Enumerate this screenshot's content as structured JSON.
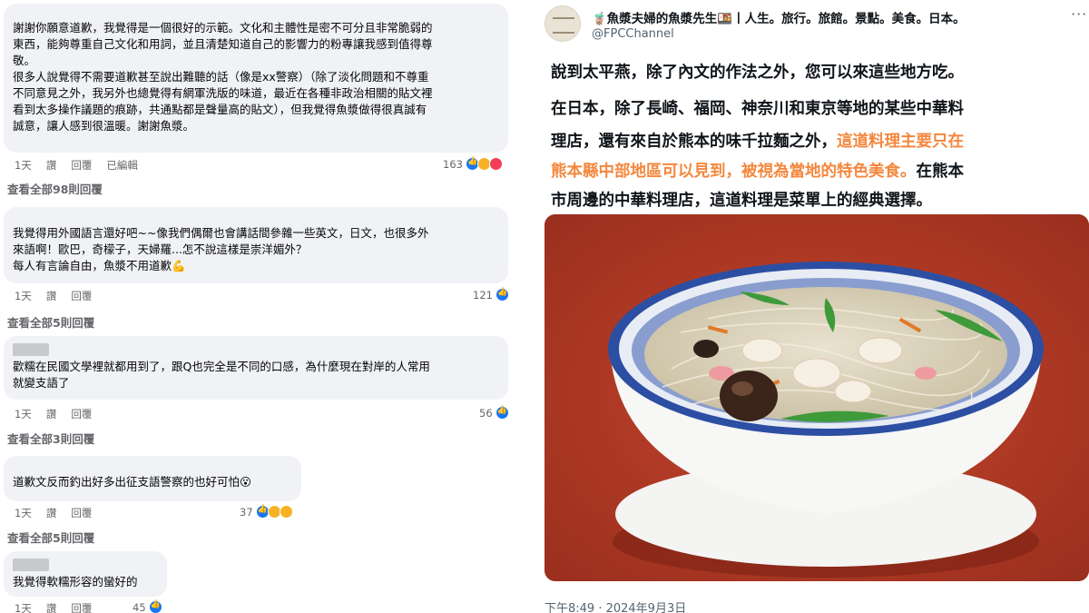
{
  "comments": [
    {
      "lines": [
        "謝謝你願意道歉，我覺得是一個很好的示範。文化和主體性是密不可分且非常脆弱的",
        "東西，能夠尊重自己文化和用詞，並且清楚知道自己的影響力的粉專讓我感到值得尊",
        "敬。",
        "很多人說覺得不需要道歉甚至說出難聽的話（像是xx警察）（除了淡化問題和不尊重",
        "不同意見之外，我另外也總覺得有網軍洗版的味道，最近在各種非政治相關的貼文裡",
        "看到太多操作議題的痕跡，共通點都是聲量高的貼文），但我覺得魚漿做得很真誠有",
        "誠意，讓人感到很溫暖。謝謝魚漿。"
      ],
      "time": "1天",
      "like": "讚",
      "reply": "回覆",
      "edited": "已編輯",
      "count": "163",
      "view_all": "查看全部98則回覆"
    },
    {
      "lines": [
        "我覺得用外國語言還好吧~~像我們偶爾也會講話間參雜一些英文，日文，也很多外",
        "來語啊！歐巴，奇檬子，天婦羅...怎不說這樣是崇洋媚外？",
        "每人有言論自由，魚漿不用道歉💪"
      ],
      "time": "1天",
      "like": "讚",
      "reply": "回覆",
      "count": "121",
      "view_all": "查看全部5則回覆"
    },
    {
      "lines": [
        "歡糯在民國文學裡就都用到了，跟Q也完全是不同的口感，為什麼現在對岸的人常用",
        "就變支語了"
      ],
      "time": "1天",
      "like": "讚",
      "reply": "回覆",
      "count": "56",
      "view_all": "查看全部3則回覆"
    },
    {
      "lines": [
        "道歉文反而釣出好多出征支語警察的也好可怕😮"
      ],
      "time": "1天",
      "like": "讚",
      "reply": "回覆",
      "count": "37",
      "view_all": "查看全部5則回覆"
    },
    {
      "lines": [
        "我覺得軟糯形容的蠻好的"
      ],
      "time": "1天",
      "like": "讚",
      "reply": "回覆",
      "count": "45"
    }
  ],
  "tweet": {
    "author": "🧋魚漿夫婦的魚漿先生🍱丨人生。旅行。旅館。景點。美食。日本。",
    "handle": "@FPCChannel",
    "more_icon": "more-icon",
    "line1": "說到太平燕，除了內文的作法之外，您可以來這些地方吃。",
    "line2": "在日本，除了長崎、福岡、神奈川和東京等地的某些中華料",
    "line3_plain": "理店，還有來自於熊本的味千拉麵之外，",
    "line3_hl": "這道料理主要只在",
    "line4_hl": "熊本縣中部地區可以見到，被視為當地的特色美食。",
    "line4_plain": "在熊本",
    "line5": "市周邊的中華料理店，這道料理是菜單上的經典選擇。",
    "timestamp": "下午8:49 · 2024年9月3日",
    "highlight_color": "#f4873d"
  }
}
